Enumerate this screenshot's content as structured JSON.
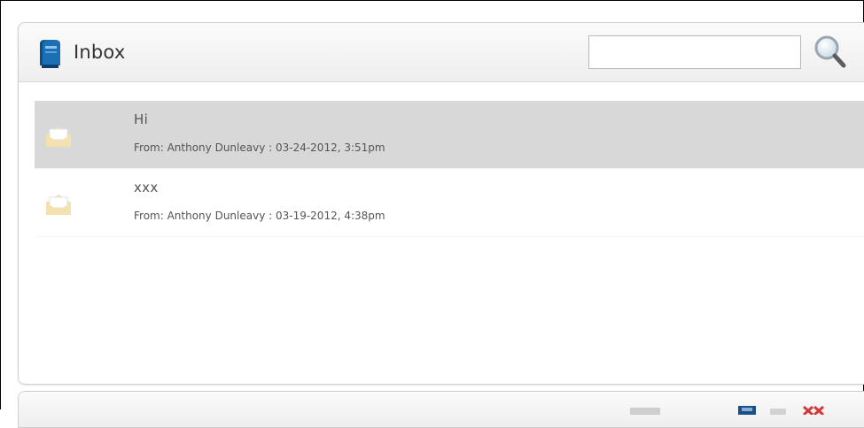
{
  "inbox": {
    "title": "Inbox",
    "search": {
      "value": "",
      "placeholder": ""
    },
    "icons": {
      "title_icon": "mailbox-icon",
      "search_icon": "magnifier-icon",
      "row_icon": "envelope-open-icon"
    }
  },
  "messages": [
    {
      "subject": "Hi",
      "meta": "From: Anthony Dunleavy : 03-24-2012, 3:51pm",
      "selected": true
    },
    {
      "subject": "xxx",
      "meta": "From: Anthony Dunleavy : 03-19-2012, 4:38pm",
      "selected": false
    }
  ],
  "toolbar": {
    "icons": [
      "view-icon",
      "save-icon",
      "document-icon",
      "delete-icon"
    ]
  },
  "colors": {
    "selected_row": "#d8d8d8",
    "mailbox_blue": "#1d6fb3",
    "envelope": "#f3e2b0",
    "delete_red": "#d23a3a"
  }
}
